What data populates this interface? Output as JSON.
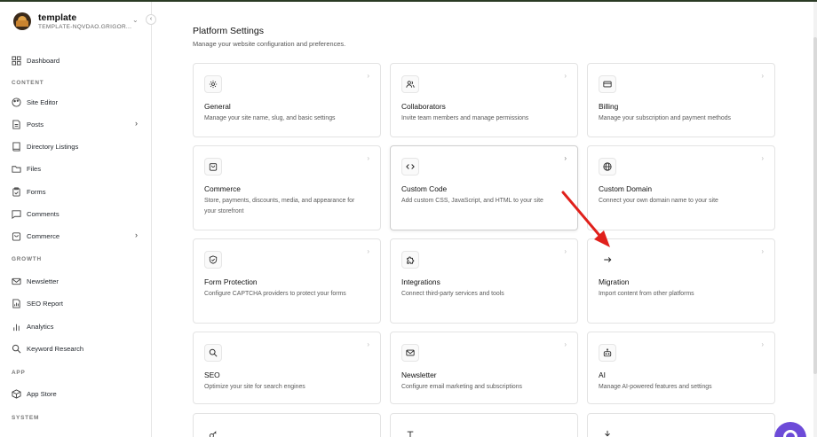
{
  "workspace": {
    "name": "template",
    "slug": "TEMPLATE-NQVDAO.GRIGOR..."
  },
  "sidebar": {
    "items": [
      {
        "label": "Dashboard",
        "icon": "dashboard-icon"
      },
      {
        "label": "Site Editor",
        "icon": "palette-icon"
      },
      {
        "label": "Posts",
        "icon": "posts-icon"
      },
      {
        "label": "Directory Listings",
        "icon": "book-icon"
      },
      {
        "label": "Files",
        "icon": "folder-icon"
      },
      {
        "label": "Forms",
        "icon": "clipboard-icon"
      },
      {
        "label": "Comments",
        "icon": "comment-icon"
      },
      {
        "label": "Commerce",
        "icon": "bag-icon"
      },
      {
        "label": "Newsletter",
        "icon": "mail-icon"
      },
      {
        "label": "SEO Report",
        "icon": "report-icon"
      },
      {
        "label": "Analytics",
        "icon": "analytics-icon"
      },
      {
        "label": "Keyword Research",
        "icon": "search-icon"
      },
      {
        "label": "App Store",
        "icon": "box-icon"
      }
    ],
    "sections": {
      "content": "CONTENT",
      "growth": "GROWTH",
      "app": "APP",
      "system": "SYSTEM"
    }
  },
  "main": {
    "title": "Platform Settings",
    "subtitle": "Manage your website configuration and preferences.",
    "cards": [
      {
        "title": "General",
        "desc": "Manage your site name, slug, and basic settings",
        "icon": "gear-icon"
      },
      {
        "title": "Collaborators",
        "desc": "Invite team members and manage permissions",
        "icon": "users-icon"
      },
      {
        "title": "Billing",
        "desc": "Manage your subscription and payment methods",
        "icon": "credit-card-icon"
      },
      {
        "title": "Commerce",
        "desc": "Store, payments, discounts, media, and appearance for your storefront",
        "icon": "shopping-bag-icon"
      },
      {
        "title": "Custom Code",
        "desc": "Add custom CSS, JavaScript, and HTML to your site",
        "icon": "code-icon"
      },
      {
        "title": "Custom Domain",
        "desc": "Connect your own domain name to your site",
        "icon": "globe-icon"
      },
      {
        "title": "Form Protection",
        "desc": "Configure CAPTCHA providers to protect your forms",
        "icon": "shield-icon"
      },
      {
        "title": "Integrations",
        "desc": "Connect third-party services and tools",
        "icon": "puzzle-icon"
      },
      {
        "title": "Migration",
        "desc": "Import content from other platforms",
        "icon": "arrow-right-icon"
      },
      {
        "title": "SEO",
        "desc": "Optimize your site for search engines",
        "icon": "search-icon"
      },
      {
        "title": "Newsletter",
        "desc": "Configure email marketing and subscriptions",
        "icon": "mail-icon"
      },
      {
        "title": "AI",
        "desc": "Manage AI-powered features and settings",
        "icon": "bot-icon"
      }
    ]
  },
  "colors": {
    "annotation_arrow": "#e0201b",
    "help_bubble": "#6d4bd8",
    "top_border": "#2a3a24"
  }
}
